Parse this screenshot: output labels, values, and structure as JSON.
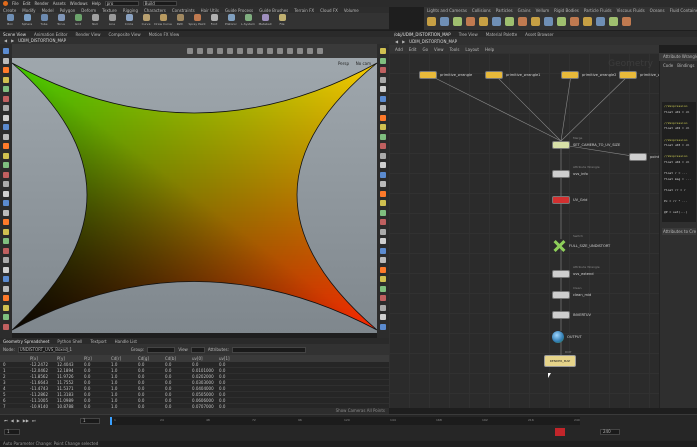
{
  "app": {
    "menu": [
      "File",
      "Edit",
      "Render",
      "Assets",
      "Windows",
      "Help"
    ],
    "desktop_field": "pro",
    "scene_field": "Build",
    "accent": "#e06a1b"
  },
  "shelf": {
    "tabs": [
      "Create",
      "Modify",
      "Model",
      "Polygon",
      "Deform",
      "Texture",
      "Rigging",
      "Characters",
      "Constraints",
      "Hair Utils",
      "Guide Process",
      "Guide Brushes",
      "Terrain FX",
      "Cloud FX",
      "Volume"
    ],
    "tools": [
      {
        "label": "Box",
        "color": "#6f8fb5"
      },
      {
        "label": "Sphere",
        "color": "#7a9ec4"
      },
      {
        "label": "Tube",
        "color": "#6c8ab0"
      },
      {
        "label": "Torus",
        "color": "#8096b8"
      },
      {
        "label": "Grid",
        "color": "#6ba36b"
      },
      {
        "label": "Null",
        "color": "#a0a0a0"
      },
      {
        "label": "Line",
        "color": "#9a9a9a"
      },
      {
        "label": "Circle",
        "color": "#8aa2c2"
      },
      {
        "label": "Curve",
        "color": "#b8a070"
      },
      {
        "label": "Draw Curve",
        "color": "#b89a60"
      },
      {
        "label": "Path",
        "color": "#a08860"
      },
      {
        "label": "Spray Paint",
        "color": "#c07a50"
      },
      {
        "label": "Font",
        "color": "#b0b0b0"
      },
      {
        "label": "Platonic",
        "color": "#7f9fbf"
      },
      {
        "label": "L-System",
        "color": "#7fae7f"
      },
      {
        "label": "Metaball",
        "color": "#9f8fbf"
      },
      {
        "label": "File",
        "color": "#c0b070"
      }
    ],
    "right_tabs": [
      "Lights and Cameras",
      "Collisions",
      "Particles",
      "Grains",
      "Vellum",
      "Rigid Bodies",
      "Particle Fluids",
      "Viscous Fluids",
      "Oceans",
      "Fluid Containers",
      "Populate Containers",
      "Container Tools",
      "Pyro FX",
      "Sparse Pyro FX",
      "FEM",
      "Wires"
    ]
  },
  "viewer": {
    "tabs": [
      "Scene View",
      "Animation Editor",
      "Render View",
      "Composite View",
      "Motion FX View"
    ],
    "path": "UDIM_DISTORTION_MAP",
    "persp": "Persp",
    "camera": "No cam"
  },
  "spreadsheet": {
    "tabs": [
      "Geometry Spreadsheet",
      "Python Shell",
      "Textport",
      "Handle List"
    ],
    "node_label": "Node:",
    "node_value": "UNDISTORT_UVS_Boxed_1",
    "group_label": "Group:",
    "view_label": "View",
    "attr_label": "Attributes:",
    "columns": [
      "",
      "P[x]",
      "P[y]",
      "P[z]",
      "Cd[r]",
      "Cd[g]",
      "Cd[b]",
      "uv[0]",
      "uv[1]"
    ],
    "rows": [
      [
        "0",
        "-12.2472",
        "12.4043",
        "0.0",
        "1.0",
        "0.0",
        "0.0",
        "0.0",
        "0.0"
      ],
      [
        "1",
        "-12.0462",
        "12.1894",
        "0.0",
        "1.0",
        "0.0",
        "0.0",
        "0.0101000",
        "0.0"
      ],
      [
        "2",
        "-11.8562",
        "11.9726",
        "0.0",
        "1.0",
        "0.0",
        "0.0",
        "0.0202000",
        "0.0"
      ],
      [
        "3",
        "-11.6643",
        "11.7552",
        "0.0",
        "1.0",
        "0.0",
        "0.0",
        "0.0303000",
        "0.0"
      ],
      [
        "4",
        "-11.4743",
        "11.5371",
        "0.0",
        "1.0",
        "0.0",
        "0.0",
        "0.0404000",
        "0.0"
      ],
      [
        "5",
        "-11.2862",
        "11.3183",
        "0.0",
        "1.0",
        "0.0",
        "0.0",
        "0.0505000",
        "0.0"
      ],
      [
        "6",
        "-11.1005",
        "11.0989",
        "0.0",
        "1.0",
        "0.0",
        "0.0",
        "0.0606000",
        "0.0"
      ],
      [
        "7",
        "-10.9140",
        "10.8788",
        "0.0",
        "1.0",
        "0.0",
        "0.0",
        "0.0707000",
        "0.0"
      ]
    ],
    "footer": "Show Cameras All Points"
  },
  "network": {
    "tabs": [
      "/obj/UDIM_DISTORTION_MAP",
      "Tree View",
      "Material Palette",
      "Asset Browser"
    ],
    "path": "UDIM_DISTORTION_MAP",
    "menu": [
      "Add",
      "Edit",
      "Go",
      "View",
      "Tools",
      "Layout",
      "Help"
    ],
    "watermark": "Geometry",
    "nodes": [
      {
        "name": "primitive_wrangle",
        "sub": "",
        "color": "#e8b93a"
      },
      {
        "name": "primitive_wrangle1",
        "sub": "",
        "color": "#e8b93a"
      },
      {
        "name": "primitive_wrangle2",
        "sub": "",
        "color": "#e8b93a"
      },
      {
        "name": "primitive_wrangle3",
        "sub": "",
        "color": "#e8b93a"
      },
      {
        "name": "SET_CAMERA_TO_UV_SIZE",
        "sub": "Merge",
        "color": "#d8e0a8"
      },
      {
        "name": "uvs_info",
        "sub": "Attribute Wrangle",
        "color": "#cfcfcf"
      },
      {
        "name": "UV_Grid",
        "sub": "",
        "color": "#d23030"
      },
      {
        "name": "FULL_SIZE_UNDISTORT",
        "sub": "Switch",
        "color": "#8ecf5a"
      },
      {
        "name": "uvs_extend",
        "sub": "Attribute Wrangle",
        "color": "#cfcfcf"
      },
      {
        "name": "clean_mid",
        "sub": "Clean",
        "color": "#cfcfcf"
      },
      {
        "name": "INVERTUV",
        "sub": "",
        "color": "#cfcfcf"
      },
      {
        "name": "OUTPUT",
        "sub": "",
        "color": "#5aa0d0"
      },
      {
        "name": "RENDER_MAP",
        "sub": "ROP",
        "color": "#e6d48a"
      },
      {
        "name": "pointwrangle",
        "sub": "",
        "color": "#cfcfcf"
      }
    ]
  },
  "params": {
    "title": "Attribute Wrangle",
    "tabs": [
      "Code",
      "Bindings"
    ],
    "code": [
      "//Vexpression",
      "float u01 = ch",
      "",
      "//Vexpression",
      "float u02 = ch",
      "",
      "//Vexpression",
      "float u03 = ch",
      "",
      "//Vexpression",
      "float u04 = ch",
      "",
      "float r = ...",
      "float mag = ...",
      "",
      "float rr = r",
      "",
      "Px = rr * ...",
      "",
      "@P = set(...)"
    ],
    "button": "Attributes to Create"
  },
  "timeline": {
    "frame": "1",
    "start": "1",
    "end": "240",
    "ticks": [
      "1",
      "24",
      "48",
      "72",
      "96",
      "120",
      "144",
      "168",
      "192",
      "216",
      "240"
    ]
  },
  "status": "Auto Parameter Change: Point Change selected"
}
